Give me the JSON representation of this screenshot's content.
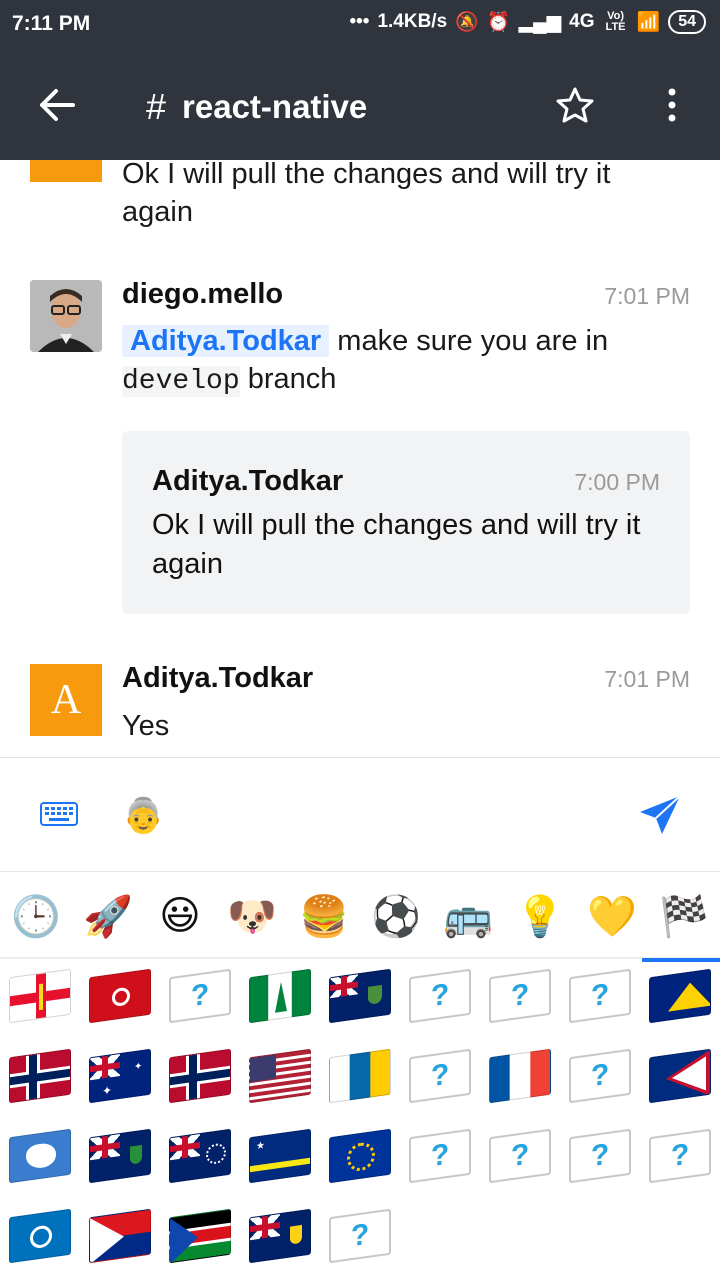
{
  "status": {
    "time": "7:11 PM",
    "speed": "1.4KB/s",
    "network": "4G",
    "volte": "Vo) LTE",
    "battery": "54"
  },
  "header": {
    "title": "react-native"
  },
  "messages": {
    "first_partial_text": "Ok I will pull the changes and will try it again",
    "second": {
      "username": "diego.mello",
      "time": "7:01 PM",
      "mention": "Aditya.Todkar",
      "text_a": "make sure you are in",
      "code": "develop",
      "text_b": "branch",
      "quote": {
        "username": "Aditya.Todkar",
        "time": "7:00 PM",
        "text": "Ok I will pull the changes and will try it again"
      }
    },
    "third": {
      "avatar_letter": "A",
      "username": "Aditya.Todkar",
      "time": "7:01 PM",
      "text": "Yes"
    }
  },
  "composer": {
    "emoji": "👵"
  },
  "emoji_categories": [
    "🕒",
    "🚀",
    "😃",
    "🐶",
    "🍔",
    "⚽",
    "🚌",
    "💡",
    "💛",
    "🏁"
  ],
  "unknown_flag_glyph": "?",
  "colors": {
    "header_bg": "#2f343d",
    "accent": "#1d74f5",
    "avatar_orange": "#f89a0e"
  }
}
